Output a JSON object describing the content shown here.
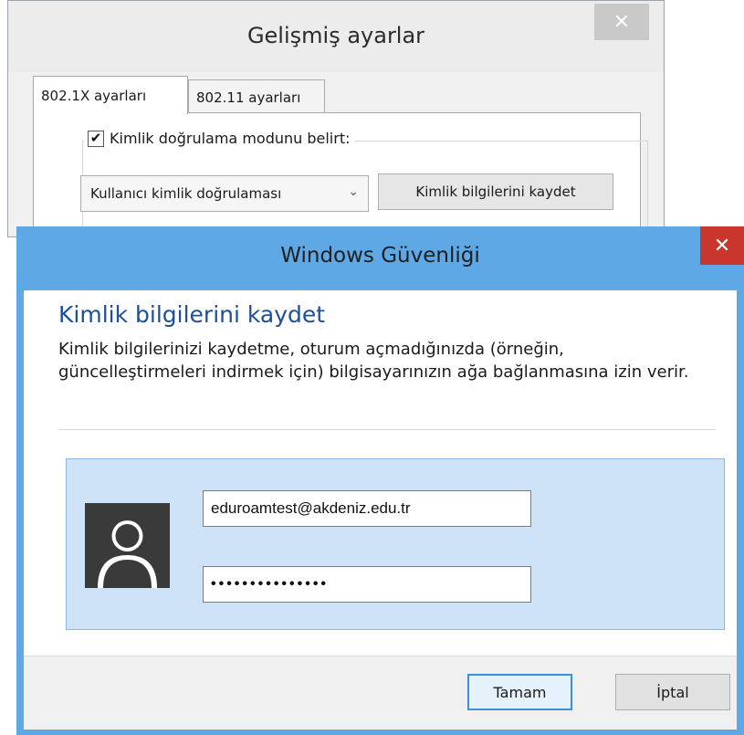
{
  "background_dialog": {
    "title": "Gelişmiş ayarlar",
    "close_glyph": "✕",
    "tabs": [
      {
        "label": "802.1X ayarları",
        "active": true
      },
      {
        "label": "802.11 ayarları",
        "active": false
      }
    ],
    "auth_mode_checkbox": {
      "label": "Kimlik doğrulama modunu belirt:",
      "checked": true,
      "glyph": "✔"
    },
    "auth_mode_select": {
      "value": "Kullanıcı kimlik doğrulaması",
      "chevron": "⌄"
    },
    "save_credentials_button": "Kimlik bilgilerini kaydet"
  },
  "foreground_dialog": {
    "title": "Windows Güvenliği",
    "close_glyph": "✕",
    "heading": "Kimlik bilgilerini kaydet",
    "description": "Kimlik bilgilerinizi kaydetme, oturum açmadığınızda (örneğin, güncelleştirmeleri indirmek için) bilgisayarınızın ağa bağlanmasına izin verir.",
    "username": "eduroamtest@akdeniz.edu.tr",
    "password_mask": "•••••••••••••••",
    "avatar_icon": "user-avatar-icon",
    "ok_button": "Tamam",
    "cancel_button": "İptal"
  },
  "colors": {
    "accent_titlebar": "#5ea8e6",
    "close_red": "#c9362d",
    "heading_blue": "#1e4f99",
    "credential_tile": "#cfe3f8"
  }
}
